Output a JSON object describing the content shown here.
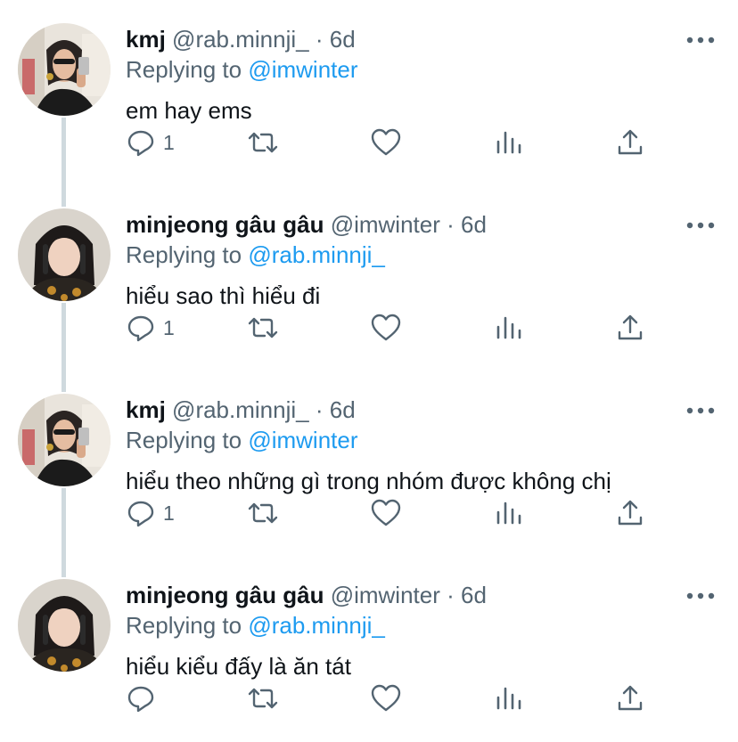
{
  "colors": {
    "text": "#0f1419",
    "secondary": "#536471",
    "accent": "#1d9bf0",
    "thread_line": "#cfd9de"
  },
  "tweets": [
    {
      "name": "kmj",
      "handle": "@rab.minnji_",
      "separator": "·",
      "time": "6d",
      "replying_label": "Replying to",
      "replying_to": "@imwinter",
      "text": "em hay ems",
      "reply_count": "1",
      "avatar": "kmj-avatar"
    },
    {
      "name": "minjeong gâu gâu",
      "handle": "@imwinter",
      "separator": "·",
      "time": "6d",
      "replying_label": "Replying to",
      "replying_to": "@rab.minnji_",
      "text": "hiểu sao thì hiểu đi",
      "reply_count": "1",
      "avatar": "minjeong-avatar"
    },
    {
      "name": "kmj",
      "handle": "@rab.minnji_",
      "separator": "·",
      "time": "6d",
      "replying_label": "Replying to",
      "replying_to": "@imwinter",
      "text": "hiểu theo những gì trong nhóm được không chị",
      "reply_count": "1",
      "avatar": "kmj-avatar"
    },
    {
      "name": "minjeong gâu gâu",
      "handle": "@imwinter",
      "separator": "·",
      "time": "6d",
      "replying_label": "Replying to",
      "replying_to": "@rab.minnji_",
      "text": "hiểu kiểu đấy là ăn tát",
      "reply_count": "",
      "avatar": "minjeong-avatar"
    }
  ]
}
